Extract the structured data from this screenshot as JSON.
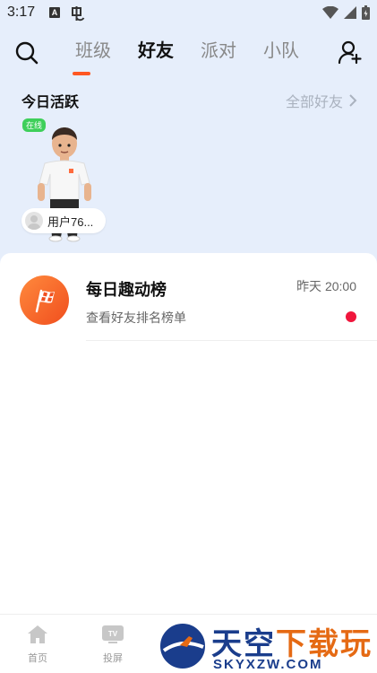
{
  "status_bar": {
    "time": "3:17",
    "a_icon": "A"
  },
  "nav": {
    "tabs": [
      {
        "label": "班级",
        "active": false
      },
      {
        "label": "好友",
        "active": true
      },
      {
        "label": "派对",
        "active": false
      },
      {
        "label": "小队",
        "active": false
      }
    ]
  },
  "active_today": {
    "title": "今日活跃",
    "all_friends_label": "全部好友",
    "friends": [
      {
        "status": "在线",
        "name": "用户76..."
      }
    ]
  },
  "list": {
    "items": [
      {
        "title": "每日趣动榜",
        "subtitle": "查看好友排名榜单",
        "time": "昨天 20:00",
        "unread": true
      }
    ]
  },
  "bottom_nav": {
    "items": [
      {
        "label": "首页",
        "icon": "home-icon"
      },
      {
        "label": "投屏",
        "icon": "tv-icon",
        "badge": "TV"
      }
    ]
  },
  "watermark": {
    "title_a": "天空",
    "title_b": "下载玩",
    "url": "SKYXZW.COM"
  },
  "colors": {
    "accent": "#ff5722",
    "online": "#3ecf5a",
    "unread": "#f0163c",
    "header_bg": "#e6eefb"
  }
}
